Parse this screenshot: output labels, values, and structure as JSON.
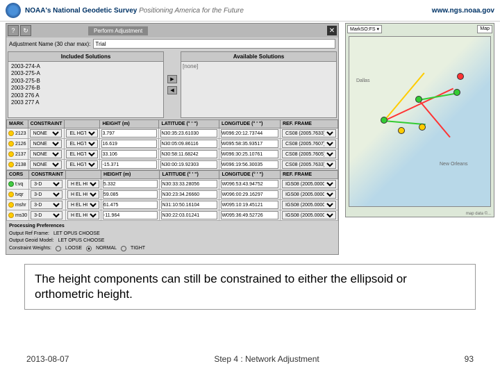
{
  "header": {
    "org": "NOAA's",
    "title": "National Geodetic Survey",
    "tagline": "Positioning America for the Future",
    "url": "www.ngs.noaa.gov"
  },
  "toolbar": {
    "help": "?",
    "refresh": "↻",
    "action_label": "Perform Adjustment",
    "close": "✕"
  },
  "adjustment": {
    "label": "Adjustment Name (30 char max):",
    "value": "Trial"
  },
  "solutions": {
    "included_header": "Included Solutions",
    "available_header": "Available Solutions",
    "included": [
      "2003-274-A",
      "2003-275-A",
      "2003-275-B",
      "2003-276-B",
      "2003 276 A",
      "2003 277 A"
    ],
    "available_none": "[none]"
  },
  "table1": {
    "headers": [
      "MARK",
      "CONSTRAINT",
      "",
      "HEIGHT (m)",
      "LATITUDE (° ' \")",
      "LONGITUDE (° ' \")",
      "REF. FRAME"
    ],
    "rows": [
      {
        "mark": "2123",
        "constraint": "NONE",
        "htype": "EL HGT",
        "h": "3.797",
        "lat": "N30:35:23.61030",
        "lon": "W096:20:12.73744",
        "ref": "CS08 (2005.7633)"
      },
      {
        "mark": "2126",
        "constraint": "NONE",
        "htype": "EL HGT",
        "h": "16.619",
        "lat": "N30:05:09.86116",
        "lon": "W095:58:35.93517",
        "ref": "CS08 (2005.7607)"
      },
      {
        "mark": "2137",
        "constraint": "NONE",
        "htype": "EL HGT",
        "h": "33.106",
        "lat": "N30:58:11.68242",
        "lon": "W096:30:25.10761",
        "ref": "CS08 (2005.7605)"
      },
      {
        "mark": "2138",
        "constraint": "NONE",
        "htype": "EL HGT",
        "h": "-15.371",
        "lat": "N30:00:19.92303",
        "lon": "W096:19:56.30035",
        "ref": "CS08 (2005.7633)"
      }
    ]
  },
  "table2": {
    "headers": [
      "CORS",
      "CONSTRAINT",
      "",
      "HEIGHT (m)",
      "LATITUDE (° ' \")",
      "LONGITUDE (° ' \")",
      "REF. FRAME"
    ],
    "rows": [
      {
        "mark": "t:vq",
        "color": "green",
        "constraint": "3-D",
        "htype": "H EL HGT",
        "h": "5.332",
        "lat": "N30:33:33.28056",
        "lon": "W096:53:43.94752",
        "ref": "IGS08 (2005.0000)"
      },
      {
        "mark": "tvqr",
        "color": "yellow",
        "constraint": "3-D",
        "htype": "H EL HGT",
        "h": "59.085",
        "lat": "N30:23:34.26660",
        "lon": "W096:00:29.16297",
        "ref": "IGS08 (2005.0000)"
      },
      {
        "mark": "mshr",
        "color": "yellow",
        "constraint": "3-D",
        "htype": "H EL HGT",
        "h": "61.475",
        "lat": "N31:10:50.16104",
        "lon": "W095:10:19.45121",
        "ref": "IGS08 (2005.0000)"
      },
      {
        "mark": "ms30",
        "color": "yellow",
        "constraint": "3-D",
        "htype": "H EL HGT",
        "h": "-11.964",
        "lat": "N30:22:03.01241",
        "lon": "W095:36:49.52726",
        "ref": "IGS08 (2005.0000)"
      }
    ]
  },
  "prefs": {
    "title": "Processing Preferences",
    "row1_label": "Output Ref Frame:",
    "row1_opt": "LET OPUS CHOOSE",
    "row2_label": "Output Geoid Model:",
    "row2_opt": "LET OPUS CHOOSE",
    "row3_label": "Constraint Weights:",
    "row3_a": "LOOSE",
    "row3_b": "NORMAL",
    "row3_c": "TIGHT"
  },
  "map": {
    "layer_label": "MarkSO:FS",
    "btn": "Map",
    "credit": "map data ©...",
    "city1": "New Orleans",
    "city2": "Dallas"
  },
  "caption": "The height components can still be constrained to either the ellipsoid or orthometric height.",
  "footer": {
    "date": "2013-08-07",
    "step": "Step 4 : Network Adjustment",
    "page": "93"
  }
}
